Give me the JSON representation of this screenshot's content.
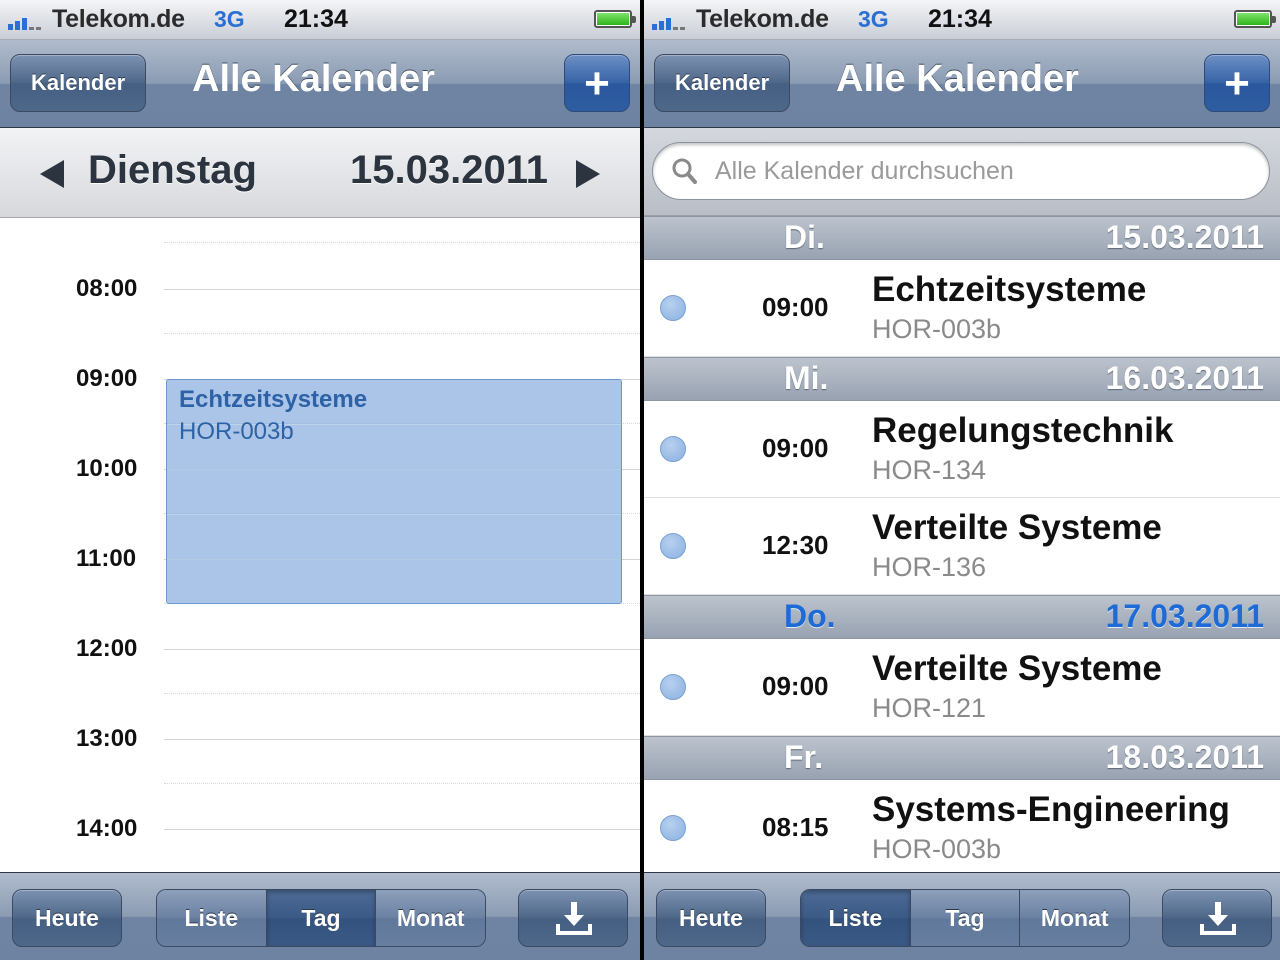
{
  "left": {
    "status": {
      "carrier": "Telekom.de",
      "network": "3G",
      "time": "21:34"
    },
    "nav": {
      "back_label": "Kalender",
      "title": "Alle Kalender",
      "add_label": "+"
    },
    "day_header": {
      "weekday": "Dienstag",
      "date": "15.03.2011"
    },
    "hours": [
      "08:00",
      "09:00",
      "10:00",
      "11:00",
      "12:00",
      "13:00",
      "14:00"
    ],
    "event": {
      "title": "Echtzeitsysteme",
      "room": "HOR-003b",
      "start": "09:00",
      "end": "11:30"
    },
    "toolbar": {
      "today": "Heute",
      "segments": [
        "Liste",
        "Tag",
        "Monat"
      ],
      "selected": "Tag"
    }
  },
  "right": {
    "status": {
      "carrier": "Telekom.de",
      "network": "3G",
      "time": "21:34"
    },
    "nav": {
      "back_label": "Kalender",
      "title": "Alle Kalender",
      "add_label": "+"
    },
    "search": {
      "placeholder": "Alle Kalender durchsuchen"
    },
    "sections": [
      {
        "day": "Di.",
        "date": "15.03.2011",
        "today": false,
        "events": [
          {
            "time": "09:00",
            "title": "Echtzeitsysteme",
            "room": "HOR-003b"
          }
        ]
      },
      {
        "day": "Mi.",
        "date": "16.03.2011",
        "today": false,
        "events": [
          {
            "time": "09:00",
            "title": "Regelungstechnik",
            "room": "HOR-134"
          },
          {
            "time": "12:30",
            "title": "Verteilte Systeme",
            "room": "HOR-136"
          }
        ]
      },
      {
        "day": "Do.",
        "date": "17.03.2011",
        "today": true,
        "events": [
          {
            "time": "09:00",
            "title": "Verteilte Systeme",
            "room": "HOR-121"
          }
        ]
      },
      {
        "day": "Fr.",
        "date": "18.03.2011",
        "today": false,
        "events": [
          {
            "time": "08:15",
            "title": "Systems-Engineering",
            "room": "HOR-003b"
          }
        ]
      }
    ],
    "toolbar": {
      "today": "Heute",
      "segments": [
        "Liste",
        "Tag",
        "Monat"
      ],
      "selected": "Liste"
    }
  },
  "colors": {
    "accent": "#1e6bd6",
    "event_fill": "#a9c4e8",
    "event_text": "#2d62a6"
  }
}
